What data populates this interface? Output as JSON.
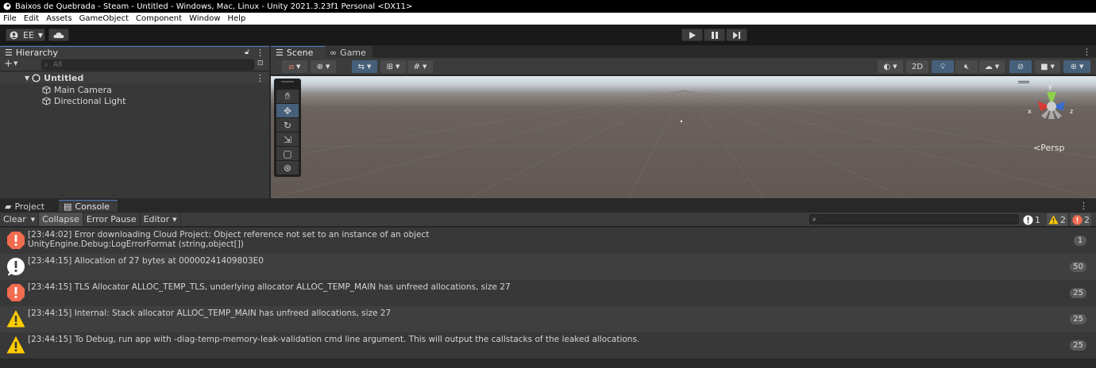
{
  "window": {
    "title": "Baixos de Quebrada - Steam - Untitled - Windows, Mac, Linux - Unity 2021.3.23f1 Personal <DX11>"
  },
  "menu": [
    "File",
    "Edit",
    "Assets",
    "GameObject",
    "Component",
    "Window",
    "Help"
  ],
  "toolbar": {
    "account_label": "EE"
  },
  "hierarchy": {
    "tab_label": "Hierarchy",
    "search_placeholder": "All",
    "scene_name": "Untitled",
    "items": [
      "Main Camera",
      "Directional Light"
    ]
  },
  "scene": {
    "tabs": [
      "Scene",
      "Game"
    ],
    "view_2d_label": "2D",
    "persp_label": "<Persp",
    "gizmo_x": "x",
    "gizmo_z": "z",
    "gizmo_y": "y"
  },
  "bottom": {
    "tabs": [
      "Project",
      "Console"
    ],
    "console_buttons": [
      "Clear",
      "Collapse",
      "Error Pause",
      "Editor"
    ],
    "counts": {
      "info": "1",
      "warning": "2",
      "error": "2"
    }
  },
  "logs": [
    {
      "type": "error",
      "text": "[23:44:02] Error downloading Cloud Project: Object reference not set to an instance of an object\nUnityEngine.Debug:LogErrorFormat (string,object[])",
      "count": "1"
    },
    {
      "type": "info",
      "text": "[23:44:15] Allocation of 27 bytes at 00000241409803E0",
      "count": "50"
    },
    {
      "type": "error",
      "text": "[23:44:15] TLS Allocator ALLOC_TEMP_TLS, underlying allocator ALLOC_TEMP_MAIN has unfreed allocations, size 27",
      "count": "25"
    },
    {
      "type": "warning",
      "text": "[23:44:15] Internal: Stack allocator ALLOC_TEMP_MAIN has unfreed allocations, size 27",
      "count": "25"
    },
    {
      "type": "warning",
      "text": "[23:44:15] To Debug, run app with -diag-temp-memory-leak-validation cmd line argument. This will output the callstacks of the leaked allocations.",
      "count": "25"
    }
  ],
  "colors": {
    "error": "#f26c4f",
    "warning": "#ffcc00",
    "info": "#ffffff",
    "accent": "#46607c"
  }
}
